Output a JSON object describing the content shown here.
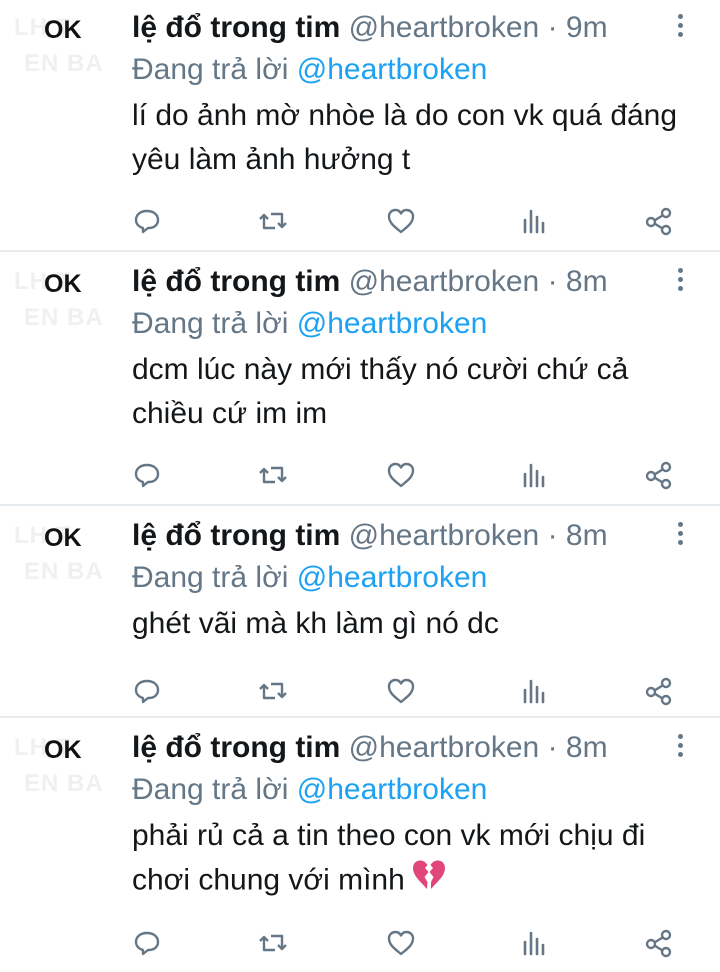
{
  "avatar": {
    "label": "OK",
    "ghost_line1": "LH    T",
    "ghost_line2": "EN BA"
  },
  "tweets": [
    {
      "display_name": "lệ đổ trong tim",
      "handle": "@heartbroken",
      "separator": "·",
      "time": "9m",
      "reply_prefix": "Đang trả lời",
      "reply_mention": "@heartbroken",
      "text": "lí do ảnh mờ nhòe là do con vk quá đáng yêu làm ảnh hưởng t",
      "emoji_icon": ""
    },
    {
      "display_name": "lệ đổ trong tim",
      "handle": "@heartbroken",
      "separator": "·",
      "time": "8m",
      "reply_prefix": "Đang trả lời",
      "reply_mention": "@heartbroken",
      "text": "dcm lúc này mới thấy nó cười chứ cả chiều cứ im im",
      "emoji_icon": ""
    },
    {
      "display_name": "lệ đổ trong tim",
      "handle": "@heartbroken",
      "separator": "·",
      "time": "8m",
      "reply_prefix": "Đang trả lời",
      "reply_mention": "@heartbroken",
      "text": "ghét vãi mà kh làm gì nó dc",
      "emoji_icon": ""
    },
    {
      "display_name": "lệ đổ trong tim",
      "handle": "@heartbroken",
      "separator": "·",
      "time": "8m",
      "reply_prefix": "Đang trả lời",
      "reply_mention": "@heartbroken",
      "text": "phải rủ cả a tin theo con vk mới chịu đi chơi chung với mình",
      "emoji_icon": "broken-heart-icon"
    }
  ],
  "action_icons": [
    "reply-icon",
    "retweet-icon",
    "like-icon",
    "analytics-icon",
    "share-icon"
  ],
  "colors": {
    "text": "#14171a",
    "secondary": "#657786",
    "link": "#1da1f2",
    "divider": "#e6ecf0",
    "broken_heart": "#e0467a"
  }
}
